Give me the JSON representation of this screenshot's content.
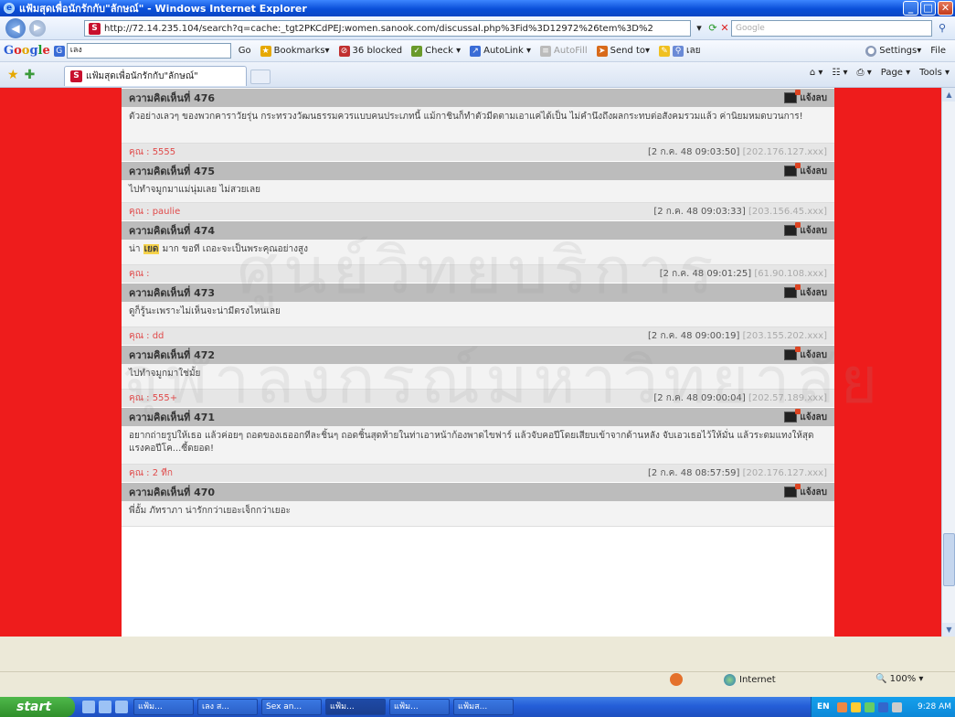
{
  "window": {
    "title": "แฟ้มสุดเพื่อนักรักกับ\"ลักษณ์\" - Windows Internet Explorer",
    "minimize": "_",
    "maximize": "□",
    "close": "✕"
  },
  "addressbar": {
    "url": "http://72.14.235.104/search?q=cache:_tgt2PKCdPEJ:women.sanook.com/discussal.php%3Fid%3D12972%26tem%3D%2",
    "search_placeholder": "Google"
  },
  "google_toolbar": {
    "search_value": "เลง",
    "items": [
      "Go",
      "Bookmarks▾",
      "36 blocked",
      "Check ▾",
      "AutoLink ▾",
      "AutoFill",
      "Send to▾",
      "เลย",
      "Settings▾",
      "File"
    ]
  },
  "tab": {
    "title": "แฟ้มสุดเพื่อนักรักกับ\"ลักษณ์\"",
    "commands": [
      "Page ▾",
      "Tools ▾"
    ]
  },
  "posts": [
    {
      "title": "ความคิดเห็นที่ 476",
      "report": "แจ้งลบ",
      "body": "ตัวอย่างเลวๆ ของพวกคาราวัยรุ่น กระทรวงวัฒนธรรมควรแบบคนประเภทนี้ แม้กาชินก็ทำตัวมีดตามเอาแค่ได้เป็น ไม่คำนึงถึงผลกระทบต่อสังคมรวมแล้ว ค่านิยมหมดบวนการ!",
      "body_pre": "",
      "body_highlight": "",
      "body_post": "",
      "author": "คุณ : 5555",
      "stamp": "[2 ก.ค. 48 09:03:50]",
      "ip": "[202.176.127.xxx]"
    },
    {
      "title": "ความคิดเห็นที่ 475",
      "report": "แจ้งลบ",
      "body": "ไปทำจมูกมาแม่นุ่มเลย ไม่สวยเลย",
      "body_pre": "",
      "body_highlight": "",
      "body_post": "",
      "author": "คุณ : paulie",
      "stamp": "[2 ก.ค. 48 09:03:33]",
      "ip": "[203.156.45.xxx]"
    },
    {
      "title": "ความคิดเห็นที่ 474",
      "report": "แจ้งลบ",
      "body": "",
      "body_pre": "น่า ",
      "body_highlight": "เยด",
      "body_post": " มาก ขอที เถอะจะเป็นพระคุณอย่างสูง",
      "author": "คุณ :",
      "stamp": "[2 ก.ค. 48 09:01:25]",
      "ip": "[61.90.108.xxx]"
    },
    {
      "title": "ความคิดเห็นที่ 473",
      "report": "แจ้งลบ",
      "body": "ดูก็รู้นะเพราะไม่เห็นจะน่ามีตรงไหนเลย",
      "body_pre": "",
      "body_highlight": "",
      "body_post": "",
      "author": "คุณ : dd",
      "stamp": "[2 ก.ค. 48 09:00:19]",
      "ip": "[203.155.202.xxx]"
    },
    {
      "title": "ความคิดเห็นที่ 472",
      "report": "แจ้งลบ",
      "body": "ไปทำจมูกมาใช่มั้ย",
      "body_pre": "",
      "body_highlight": "",
      "body_post": "",
      "author": "คุณ : 555+",
      "stamp": "[2 ก.ค. 48 09:00:04]",
      "ip": "[202.57.189.xxx]"
    },
    {
      "title": "ความคิดเห็นที่ 471",
      "report": "แจ้งลบ",
      "body": "อยากถ่ายรูปให้เธอ แล้วค่อยๆ ถอดของเธออกทีละชิ้นๆ ถอดชิ้นสุดท้ายในท่าเอาหน้าก้องพาดไขฟาร์ แล้วจับคอปีโดยเสียบเข้าจากด้านหลัง จับเอวเธอไว้ให้มั่น แล้วระดมแทงให้สุดแรงคอปีโค...ซี้ดยอด!",
      "body_pre": "",
      "body_highlight": "",
      "body_post": "",
      "author": "คุณ : 2 ทีก",
      "stamp": "[2 ก.ค. 48 08:57:59]",
      "ip": "[202.176.127.xxx]"
    },
    {
      "title": "ความคิดเห็นที่ 470",
      "report": "แจ้งลบ",
      "body": "พี่อั้ม ภัทราภา น่ารักกว่าเยอะเจ็กกว่าเยอะ",
      "body_pre": "",
      "body_highlight": "",
      "body_post": "",
      "author": "",
      "stamp": "",
      "ip": ""
    }
  ],
  "watermark": [
    "ศูนย์วิทยบริการ",
    "จุฬาลงกรณ์มหาวิทยาลัย"
  ],
  "statusbar": {
    "zone": "Internet",
    "zoom": "100%"
  },
  "taskbar": {
    "start": "start",
    "tasks": [
      "แฟ้ม...",
      "เลง ส...",
      "Sex an...",
      "แฟ้ม...",
      "แฟ้ม...",
      "แฟ้มส..."
    ],
    "lang": "EN",
    "clock": "9:28 AM"
  },
  "colors": {
    "page_bg": "#ee1c1c",
    "post_header": "#bcbcbc",
    "author": "#e04a4a"
  }
}
